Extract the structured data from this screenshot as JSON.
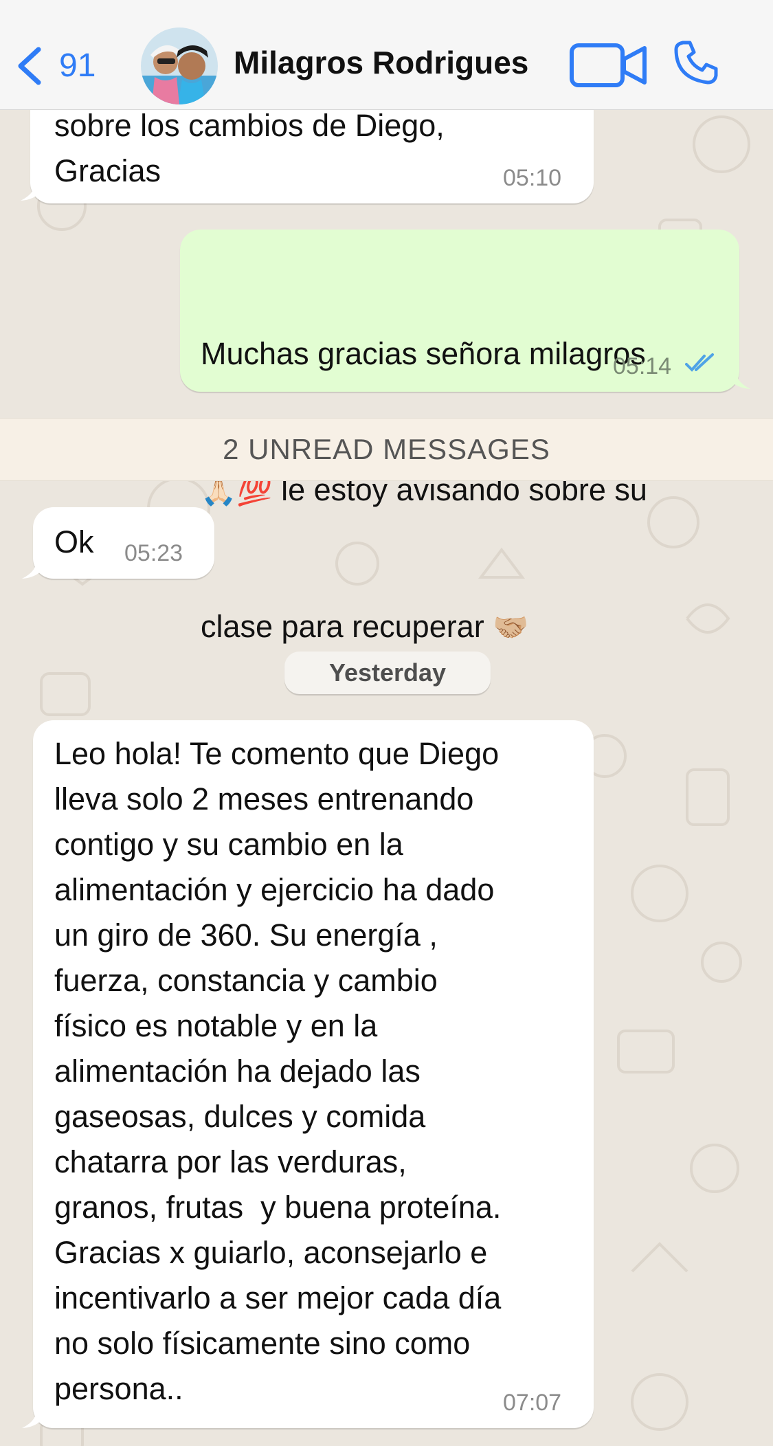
{
  "header": {
    "back_count": "91",
    "contact_name": "Milagros Rodrigues",
    "accent_color": "#2f7cf6"
  },
  "messages": [
    {
      "direction": "incoming",
      "text": "sobre los cambios de Diego,\nGracias",
      "time": "05:10"
    },
    {
      "direction": "outgoing",
      "text_line1": "Muchas gracias señora milagros",
      "emoji_line2": "🙏🏻💯",
      "text_line2": " le estoy avisando sobre su",
      "text_line3": "clase para recuperar ",
      "emoji_line3": "🤝🏼",
      "time": "05:14",
      "status": "read"
    },
    {
      "direction": "incoming",
      "text": "Ok",
      "time": "05:23"
    },
    {
      "direction": "incoming",
      "text": "Leo hola! Te comento que Diego\nlleva solo 2 meses entrenando\ncontigo y su cambio en la\nalimentación y ejercicio ha dado\nun giro de 360. Su energía ,\nfuerza, constancia y cambio\nfísico es notable y en la\nalimentación ha dejado las\ngaseosas, dulces y comida\nchatarra por las verduras,\ngranos, frutas  y buena proteína.\nGracias x guiarlo, aconsejarlo e\nincentivarlo a ser mejor cada día\nno solo físicamente sino como\npersona..",
      "time": "07:07"
    }
  ],
  "unread_banner": "2 UNREAD MESSAGES",
  "day_separator": "Yesterday",
  "icons": {
    "back": "chevron-left-icon",
    "video": "video-camera-icon",
    "call": "phone-icon",
    "read_receipt": "double-check-icon"
  }
}
